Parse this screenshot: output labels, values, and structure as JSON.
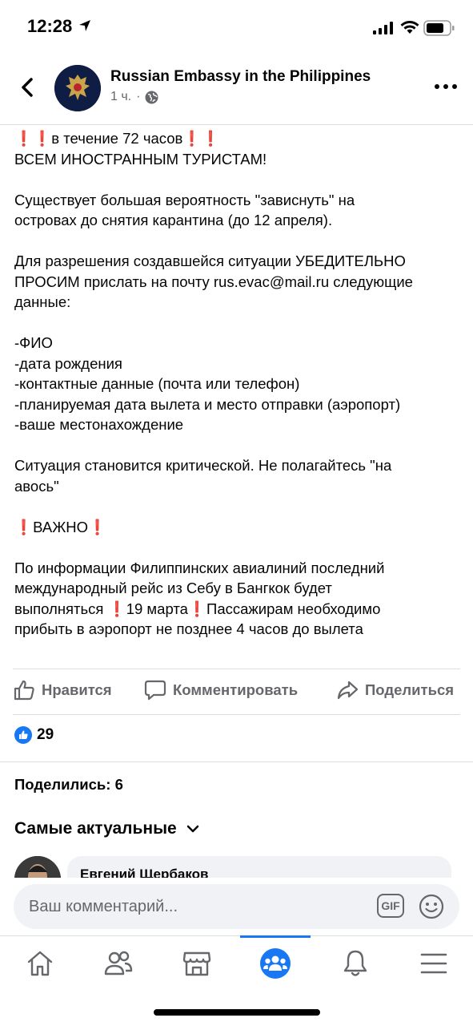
{
  "status_bar": {
    "time": "12:28"
  },
  "header": {
    "page_name": "Russian Embassy in the Philippines",
    "time_ago": "1 ч.",
    "dot": "·"
  },
  "post": {
    "line1_text": "в течение 72 часов",
    "line2": "ВСЕМ ИНОСТРАННЫМ ТУРИСТАМ!",
    "para2_l1": "Существует большая вероятность \"зависнуть\" на",
    "para2_l2": "островах до снятия карантина (до 12 апреля).",
    "para3_l1": "Для разрешения создавшейся ситуации УБЕДИТЕЛЬНО",
    "para3_l2": "ПРОСИМ прислать на почту rus.evac@mail.ru следующие",
    "para3_l3": "данные:",
    "list": [
      "-ФИО",
      "-дата рождения",
      "-контактные данные (почта или телефон)",
      "-планируемая дата вылета и место отправки (аэропорт)",
      "-ваше местонахождение"
    ],
    "para5_l1": "Ситуация становится критической. Не полагайтесь \"на",
    "para5_l2": "авось\"",
    "important": "ВАЖНО",
    "para7_l1": "По информации Филиппинских авиалиний последний",
    "para7_l2": "международный рейс из Себу в Бангкок будет",
    "para7_l3a": "выполняться",
    "para7_l3b": "19 марта",
    "para7_l3c": "Пассажирам необходимо",
    "para7_l4": "прибыть в аэропорт не позднее 4 часов до вылета",
    "exclaim": "❗"
  },
  "actions": {
    "like": "Нравится",
    "comment": "Комментировать",
    "share": "Поделиться"
  },
  "reactions": {
    "count": "29"
  },
  "shares": {
    "label": "Поделились: 6"
  },
  "sort": {
    "label": "Самые актуальные"
  },
  "comment_preview": {
    "author": "Евгений Щербаков"
  },
  "input": {
    "placeholder": "Ваш комментарий...",
    "gif": "GIF"
  },
  "colors": {
    "accent": "#1877f2",
    "muted": "#65676b",
    "alert": "#e41e3f"
  },
  "tabs": [
    "home-icon",
    "friends-icon",
    "marketplace-icon",
    "groups-icon",
    "notifications-icon",
    "menu-icon"
  ]
}
